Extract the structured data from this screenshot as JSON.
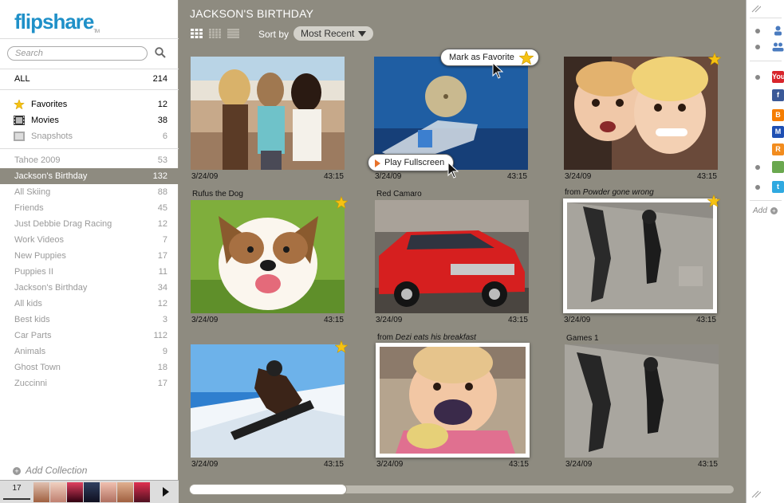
{
  "app": {
    "logo": "flipshare",
    "logo_tm": "TM"
  },
  "search": {
    "placeholder": "Search"
  },
  "library": {
    "all": {
      "label": "ALL",
      "count": "214"
    },
    "favorites": {
      "label": "Favorites",
      "count": "12"
    },
    "movies": {
      "label": "Movies",
      "count": "38"
    },
    "snapshots": {
      "label": "Snapshots",
      "count": "6"
    }
  },
  "collections": [
    {
      "label": "Tahoe 2009",
      "count": "53"
    },
    {
      "label": "Jackson's Birthday",
      "count": "132"
    },
    {
      "label": "All Skiing",
      "count": "88"
    },
    {
      "label": "Friends",
      "count": "45"
    },
    {
      "label": "Just Debbie Drag Racing",
      "count": "12"
    },
    {
      "label": "Work Videos",
      "count": "7"
    },
    {
      "label": "New Puppies",
      "count": "17"
    },
    {
      "label": "Puppies II",
      "count": "11"
    },
    {
      "label": "Jackson's Birthday",
      "count": "34"
    },
    {
      "label": "All kids",
      "count": "12"
    },
    {
      "label": "Best kids",
      "count": "3"
    },
    {
      "label": "Car Parts",
      "count": "112"
    },
    {
      "label": "Animals",
      "count": "9"
    },
    {
      "label": "Ghost Town",
      "count": "18"
    },
    {
      "label": "Zuccinni",
      "count": "17"
    }
  ],
  "add_collection": "Add Collection",
  "filmstrip": {
    "count": "17"
  },
  "main": {
    "title": "JACKSON'S BIRTHDAY",
    "sort_label": "Sort by",
    "sort_value": "Most Recent"
  },
  "tiles": [
    {
      "caption": "",
      "from": "",
      "date": "3/24/09",
      "duration": "43:15",
      "favorite": false
    },
    {
      "caption": "",
      "from": "",
      "date": "3/24/09",
      "duration": "43:15",
      "favorite": false
    },
    {
      "caption": "",
      "from": "",
      "date": "3/24/09",
      "duration": "43:15",
      "favorite": true
    },
    {
      "caption": "Rufus the Dog",
      "from": "",
      "date": "3/24/09",
      "duration": "43:15",
      "favorite": true
    },
    {
      "caption": "Red Camaro",
      "from": "",
      "date": "3/24/09",
      "duration": "43:15",
      "favorite": false
    },
    {
      "caption": "from ",
      "from": "Powder gone wrong",
      "date": "3/24/09",
      "duration": "43:15",
      "favorite": true
    },
    {
      "caption": "",
      "from": "",
      "date": "3/24/09",
      "duration": "43:15",
      "favorite": true
    },
    {
      "caption": "from ",
      "from": "Dezi eats his breakfast",
      "date": "3/24/09",
      "duration": "43:15",
      "favorite": false
    },
    {
      "caption": "Games 1",
      "from": "",
      "date": "3/24/09",
      "duration": "43:15",
      "favorite": false
    }
  ],
  "tooltips": {
    "favorite": "Mark as Favorite",
    "fullscreen": "Play Fullscreen"
  },
  "share": {
    "add_label": "Add",
    "services": [
      {
        "name": "youtube-icon",
        "text": "You",
        "color": "#d8252b"
      },
      {
        "name": "facebook-icon",
        "text": "f",
        "color": "#3b5998"
      },
      {
        "name": "blogger-icon",
        "text": "B",
        "color": "#f57d00"
      },
      {
        "name": "myspace-icon",
        "text": "M",
        "color": "#1e4fb3"
      },
      {
        "name": "rss-icon",
        "text": "R",
        "color": "#f28c1e"
      },
      {
        "name": "photo-share-icon",
        "text": "",
        "color": "#6aa84f"
      },
      {
        "name": "twitter-icon",
        "text": "t",
        "color": "#2fa9e0"
      }
    ]
  },
  "colors": {
    "accent": "#1f90c8",
    "background": "#8e8b80",
    "selected": "#8e8b80",
    "star": "#f6c212"
  }
}
